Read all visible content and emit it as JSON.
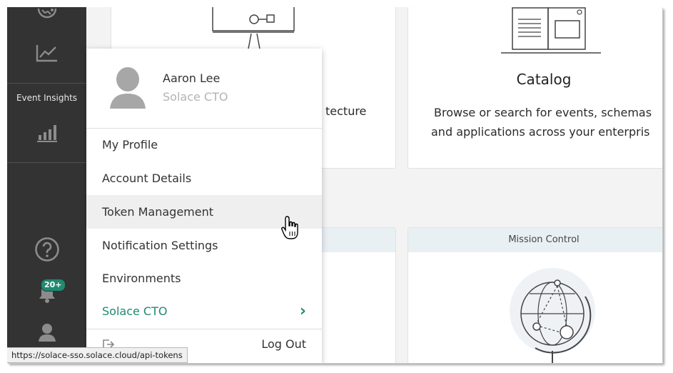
{
  "sidebar": {
    "section_label": "Event Insights",
    "notifications_badge": "20+",
    "icons": [
      "globe-icon",
      "chart-line-icon",
      "bar-chart-icon",
      "help-icon",
      "bell-icon",
      "user-icon"
    ]
  },
  "cards": {
    "designer": {
      "desc_fragment": "tecture"
    },
    "catalog": {
      "title": "Catalog",
      "desc_line1": "Browse or search for events, schemas",
      "desc_line2": "and applications across your enterpris"
    },
    "mission_control": {
      "header": "Mission Control"
    }
  },
  "user_menu": {
    "name": "Aaron Lee",
    "role": "Solace CTO",
    "items": [
      {
        "label": "My Profile"
      },
      {
        "label": "Account Details"
      },
      {
        "label": "Token Management",
        "active": true
      },
      {
        "label": "Notification Settings"
      },
      {
        "label": "Environments"
      }
    ],
    "org_label": "Solace CTO",
    "logout_label": "Log Out"
  },
  "status_bar": {
    "url": "https://solace-sso.solace.cloud/api-tokens"
  },
  "colors": {
    "sidebar": "#333333",
    "accent": "#1f8a70",
    "menu_hover": "#efefef"
  }
}
